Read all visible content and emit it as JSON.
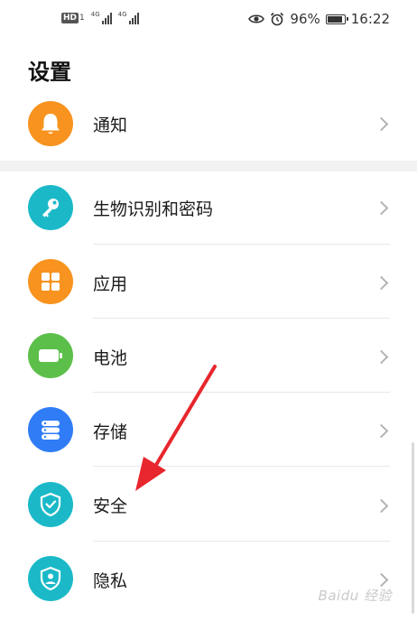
{
  "status_bar": {
    "hd_label": "HD",
    "sim_label": "1",
    "net1_label": "4G",
    "net2_label": "4G",
    "battery_percent_text": "96%",
    "battery_level": 0.96,
    "time": "16:22"
  },
  "page": {
    "title": "设置"
  },
  "settings": {
    "items": [
      {
        "label": "通知",
        "icon": "bell-icon",
        "color": "#f7931e"
      },
      {
        "label": "生物识别和密码",
        "icon": "key-icon",
        "color": "#1bb9c8"
      },
      {
        "label": "应用",
        "icon": "apps-grid-icon",
        "color": "#f7931e"
      },
      {
        "label": "电池",
        "icon": "battery-icon",
        "color": "#5cbf4a"
      },
      {
        "label": "存储",
        "icon": "storage-icon",
        "color": "#2f7cf6"
      },
      {
        "label": "安全",
        "icon": "shield-icon",
        "color": "#1bb9c8"
      },
      {
        "label": "隐私",
        "icon": "privacy-icon",
        "color": "#1bb9c8"
      }
    ]
  },
  "annotation": {
    "arrow_color": "#e8262d"
  },
  "watermark": {
    "text": "Baidu 经验"
  }
}
